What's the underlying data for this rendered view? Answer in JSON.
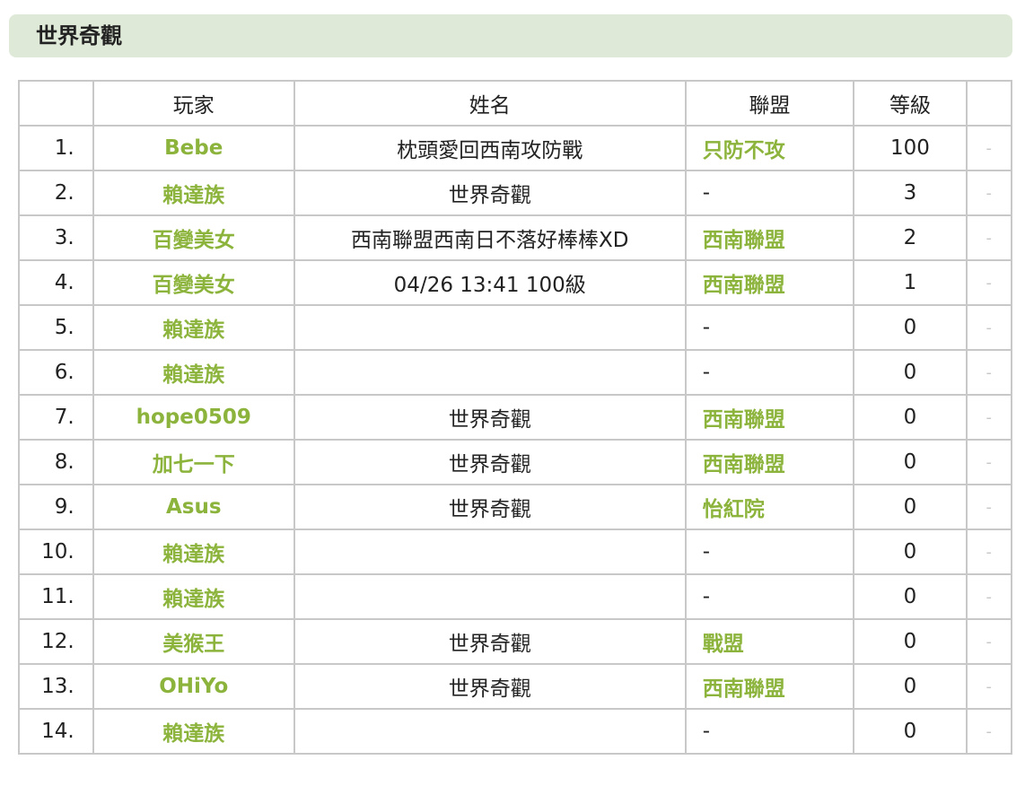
{
  "header": {
    "title": "世界奇觀"
  },
  "table": {
    "columns": [
      "",
      "玩家",
      "姓名",
      "聯盟",
      "等級",
      ""
    ],
    "rows": [
      {
        "rank": "1.",
        "player": "Bebe",
        "name": "枕頭愛回西南攻防戰",
        "alliance": "只防不攻",
        "alliance_link": true,
        "level": "100",
        "extra": "-"
      },
      {
        "rank": "2.",
        "player": "賴達族",
        "name": "世界奇觀",
        "alliance": "-",
        "alliance_link": false,
        "level": "3",
        "extra": "-"
      },
      {
        "rank": "3.",
        "player": "百變美女",
        "name": "西南聯盟西南日不落好棒棒XD",
        "alliance": "西南聯盟",
        "alliance_link": true,
        "level": "2",
        "extra": "-"
      },
      {
        "rank": "4.",
        "player": "百變美女",
        "name": "04/26 13:41 100級",
        "alliance": "西南聯盟",
        "alliance_link": true,
        "level": "1",
        "extra": "-"
      },
      {
        "rank": "5.",
        "player": "賴達族",
        "name": "",
        "alliance": "-",
        "alliance_link": false,
        "level": "0",
        "extra": "-"
      },
      {
        "rank": "6.",
        "player": "賴達族",
        "name": "",
        "alliance": "-",
        "alliance_link": false,
        "level": "0",
        "extra": "-"
      },
      {
        "rank": "7.",
        "player": "hope0509",
        "name": "世界奇觀",
        "alliance": "西南聯盟",
        "alliance_link": true,
        "level": "0",
        "extra": "-"
      },
      {
        "rank": "8.",
        "player": "加七一下",
        "name": "世界奇觀",
        "alliance": "西南聯盟",
        "alliance_link": true,
        "level": "0",
        "extra": "-"
      },
      {
        "rank": "9.",
        "player": "Asus",
        "name": "世界奇觀",
        "alliance": "怡紅院",
        "alliance_link": true,
        "level": "0",
        "extra": "-"
      },
      {
        "rank": "10.",
        "player": "賴達族",
        "name": "",
        "alliance": "-",
        "alliance_link": false,
        "level": "0",
        "extra": "-"
      },
      {
        "rank": "11.",
        "player": "賴達族",
        "name": "",
        "alliance": "-",
        "alliance_link": false,
        "level": "0",
        "extra": "-"
      },
      {
        "rank": "12.",
        "player": "美猴王",
        "name": "世界奇觀",
        "alliance": "戰盟",
        "alliance_link": true,
        "level": "0",
        "extra": "-"
      },
      {
        "rank": "13.",
        "player": "OHiYo",
        "name": "世界奇觀",
        "alliance": "西南聯盟",
        "alliance_link": true,
        "level": "0",
        "extra": "-"
      },
      {
        "rank": "14.",
        "player": "賴達族",
        "name": "",
        "alliance": "-",
        "alliance_link": false,
        "level": "0",
        "extra": "-"
      }
    ]
  },
  "colors": {
    "link": "#8cb43c",
    "header_bg": "#dfe9d8",
    "border": "#c8c8c8"
  }
}
